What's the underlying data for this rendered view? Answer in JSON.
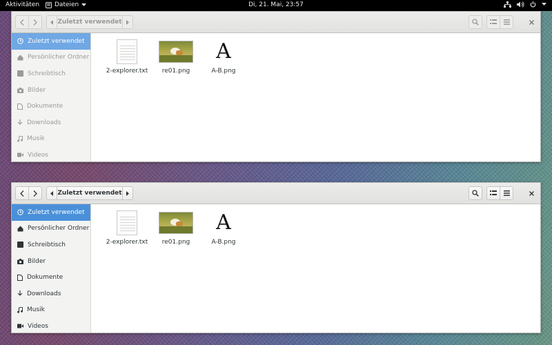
{
  "topbar": {
    "activities": "Aktivitäten",
    "app_menu": "Dateien",
    "clock": "Di, 21. Mai, 23:57"
  },
  "windows": [
    {
      "state": "inactive",
      "path_label": "Zuletzt verwendet",
      "sidebar": [
        {
          "label": "Zuletzt verwendet",
          "icon": "clock-icon",
          "active": true
        },
        {
          "label": "Persönlicher Ordner",
          "icon": "home-icon"
        },
        {
          "label": "Schreibtisch",
          "icon": "desktop-icon"
        },
        {
          "label": "Bilder",
          "icon": "camera-icon"
        },
        {
          "label": "Dokumente",
          "icon": "document-icon"
        },
        {
          "label": "Downloads",
          "icon": "download-icon"
        },
        {
          "label": "Musik",
          "icon": "music-icon"
        },
        {
          "label": "Videos",
          "icon": "video-icon"
        }
      ],
      "files": [
        {
          "name": "2-explorer.txt",
          "type": "text"
        },
        {
          "name": "re01.png",
          "type": "photo"
        },
        {
          "name": "A-B.png",
          "type": "letter",
          "glyph": "A"
        }
      ]
    },
    {
      "state": "active",
      "path_label": "Zuletzt verwendet",
      "sidebar": [
        {
          "label": "Zuletzt verwendet",
          "icon": "clock-icon",
          "active": true
        },
        {
          "label": "Persönlicher Ordner",
          "icon": "home-icon"
        },
        {
          "label": "Schreibtisch",
          "icon": "desktop-icon"
        },
        {
          "label": "Bilder",
          "icon": "camera-icon"
        },
        {
          "label": "Dokumente",
          "icon": "document-icon"
        },
        {
          "label": "Downloads",
          "icon": "download-icon"
        },
        {
          "label": "Musik",
          "icon": "music-icon"
        },
        {
          "label": "Videos",
          "icon": "video-icon"
        }
      ],
      "files": [
        {
          "name": "2-explorer.txt",
          "type": "text"
        },
        {
          "name": "re01.png",
          "type": "photo"
        },
        {
          "name": "A-B.png",
          "type": "letter",
          "glyph": "A"
        }
      ]
    }
  ],
  "colors": {
    "accent": "#4a90d9",
    "topbar": "#000000"
  }
}
